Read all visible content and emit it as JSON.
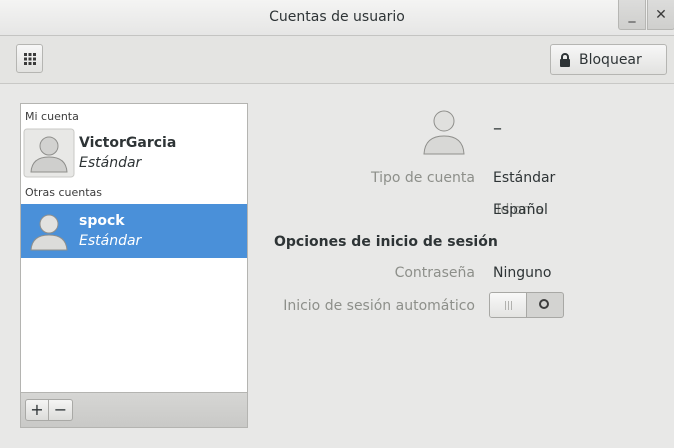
{
  "window": {
    "title": "Cuentas de usuario",
    "minimize_label": "_",
    "close_label": "✕"
  },
  "toolbar": {
    "lock_label": "Bloquear",
    "grid_icon": "grid-icon",
    "lock_icon": "lock-icon"
  },
  "accounts": {
    "my_account_header": "Mi cuenta",
    "other_accounts_header": "Otras cuentas",
    "items": [
      {
        "name": "VictorGarcia",
        "type": "Estándar",
        "selected": false
      },
      {
        "name": "spock",
        "type": "Estándar",
        "selected": true
      }
    ],
    "add_label": "+",
    "remove_label": "−"
  },
  "detail": {
    "full_name": "–",
    "account_type_label": "Tipo de cuenta",
    "account_type_value": "Estándar",
    "language_label": "Idioma",
    "language_value": "Español",
    "login_options_title": "Opciones de inicio de sesión",
    "password_label": "Contraseña",
    "password_value": "Ninguno",
    "autologin_label": "Inicio de sesión automático",
    "autologin_enabled": false
  },
  "colors": {
    "selection": "#4a90d9",
    "dim_label": "#8d8f8a"
  }
}
